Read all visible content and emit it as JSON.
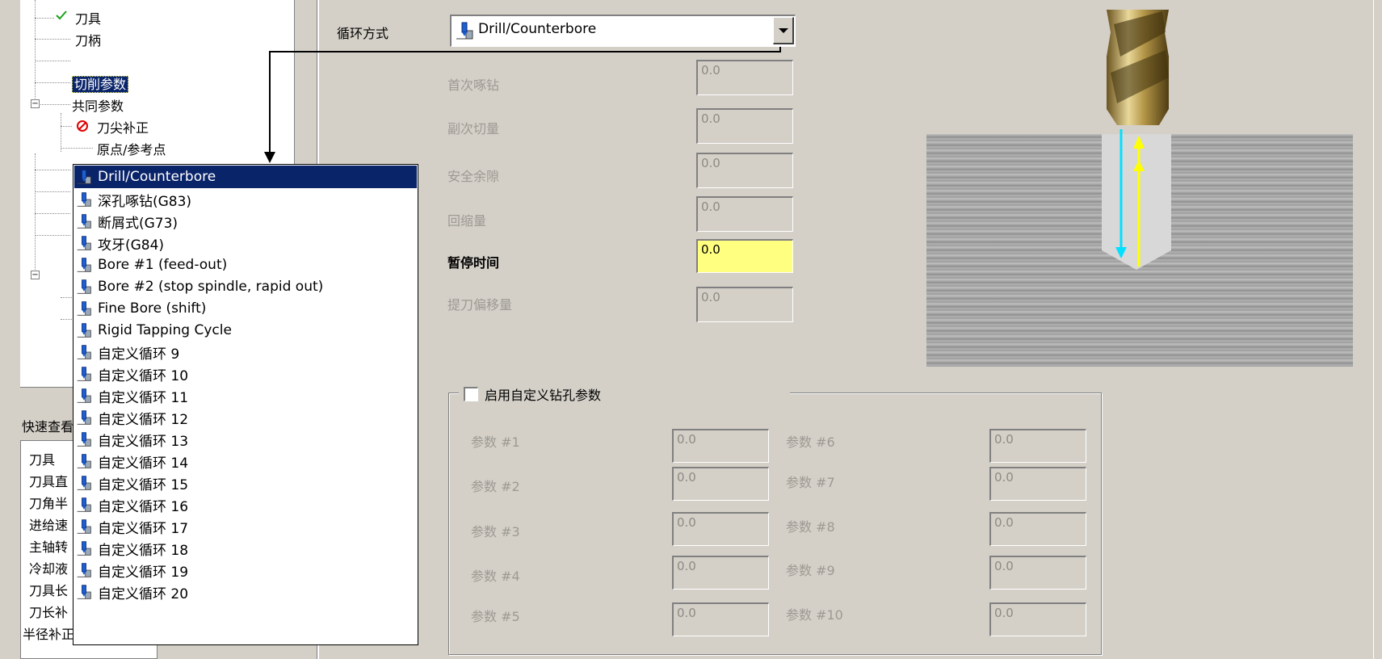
{
  "tree": {
    "items": [
      "刀具",
      "刀柄",
      "切削参数",
      "共同参数",
      "刀尖补正",
      "原点/参考点"
    ]
  },
  "quick_view": {
    "label": "快速查看",
    "rows": [
      "刀具",
      "刀具直",
      "刀角半",
      "进给速",
      "主轴转",
      "冷却液",
      "刀具长",
      "刀长补",
      "半径补正"
    ]
  },
  "cycle": {
    "label": "循环方式",
    "value": "Drill/Counterbore"
  },
  "dropdown": {
    "options": [
      "Drill/Counterbore",
      "深孔啄钻(G83)",
      "断屑式(G73)",
      "攻牙(G84)",
      "Bore #1 (feed-out)",
      "Bore #2 (stop spindle, rapid out)",
      "Fine Bore (shift)",
      "Rigid Tapping Cycle",
      "自定义循环 9",
      "自定义循环 10",
      "自定义循环 11",
      "自定义循环 12",
      "自定义循环 13",
      "自定义循环 14",
      "自定义循环 15",
      "自定义循环 16",
      "自定义循环 17",
      "自定义循环 18",
      "自定义循环 19",
      "自定义循环 20"
    ]
  },
  "fields": [
    {
      "label": "首次啄钻",
      "value": "0.0"
    },
    {
      "label": "副次切量",
      "value": "0.0"
    },
    {
      "label": "安全余隙",
      "value": "0.0"
    },
    {
      "label": "回缩量",
      "value": "0.0"
    },
    {
      "label": "暂停时间",
      "value": "0.0"
    },
    {
      "label": "提刀偏移量",
      "value": "0.0"
    }
  ],
  "custom": {
    "checkbox_label": "启用自定义钻孔参数",
    "params": [
      {
        "label": "参数 #1",
        "value": "0.0"
      },
      {
        "label": "参数 #2",
        "value": "0.0"
      },
      {
        "label": "参数 #3",
        "value": "0.0"
      },
      {
        "label": "参数 #4",
        "value": "0.0"
      },
      {
        "label": "参数 #5",
        "value": "0.0"
      },
      {
        "label": "参数 #6",
        "value": "0.0"
      },
      {
        "label": "参数 #7",
        "value": "0.0"
      },
      {
        "label": "参数 #8",
        "value": "0.0"
      },
      {
        "label": "参数 #9",
        "value": "0.0"
      },
      {
        "label": "参数 #10",
        "value": "0.0"
      }
    ]
  },
  "colors": {
    "window_bg": "#d4d0c8",
    "selection": "#0a246a",
    "highlight_field": "#ffff80",
    "checkmark": "#1aa01a",
    "forbidden": "#e00000",
    "preview_arrow_cyan": "#00e0ff",
    "preview_arrow_yellow": "#ffff00"
  },
  "icons": {
    "tree_check": "checkmark-icon",
    "tree_forbidden": "forbidden-icon",
    "cycle_item": "drill-cycle-icon"
  }
}
